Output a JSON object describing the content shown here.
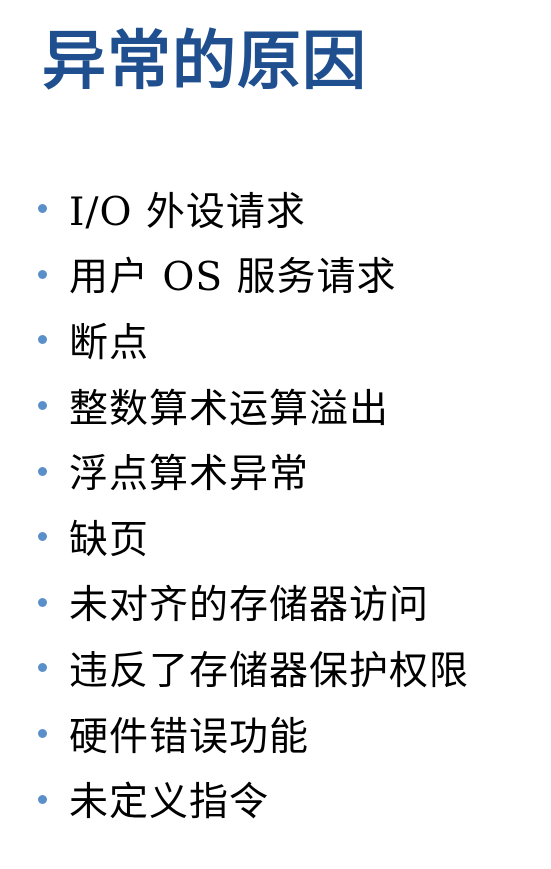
{
  "slide": {
    "title": "异常的原因",
    "bullet_color": "#5b8fc9",
    "title_color": "#1f4f8f",
    "items": [
      "I/O 外设请求",
      "用户 OS 服务请求",
      "断点",
      "整数算术运算溢出",
      "浮点算术异常",
      "缺页",
      "未对齐的存储器访问",
      "违反了存储器保护权限",
      "硬件错误功能",
      "未定义指令"
    ]
  }
}
